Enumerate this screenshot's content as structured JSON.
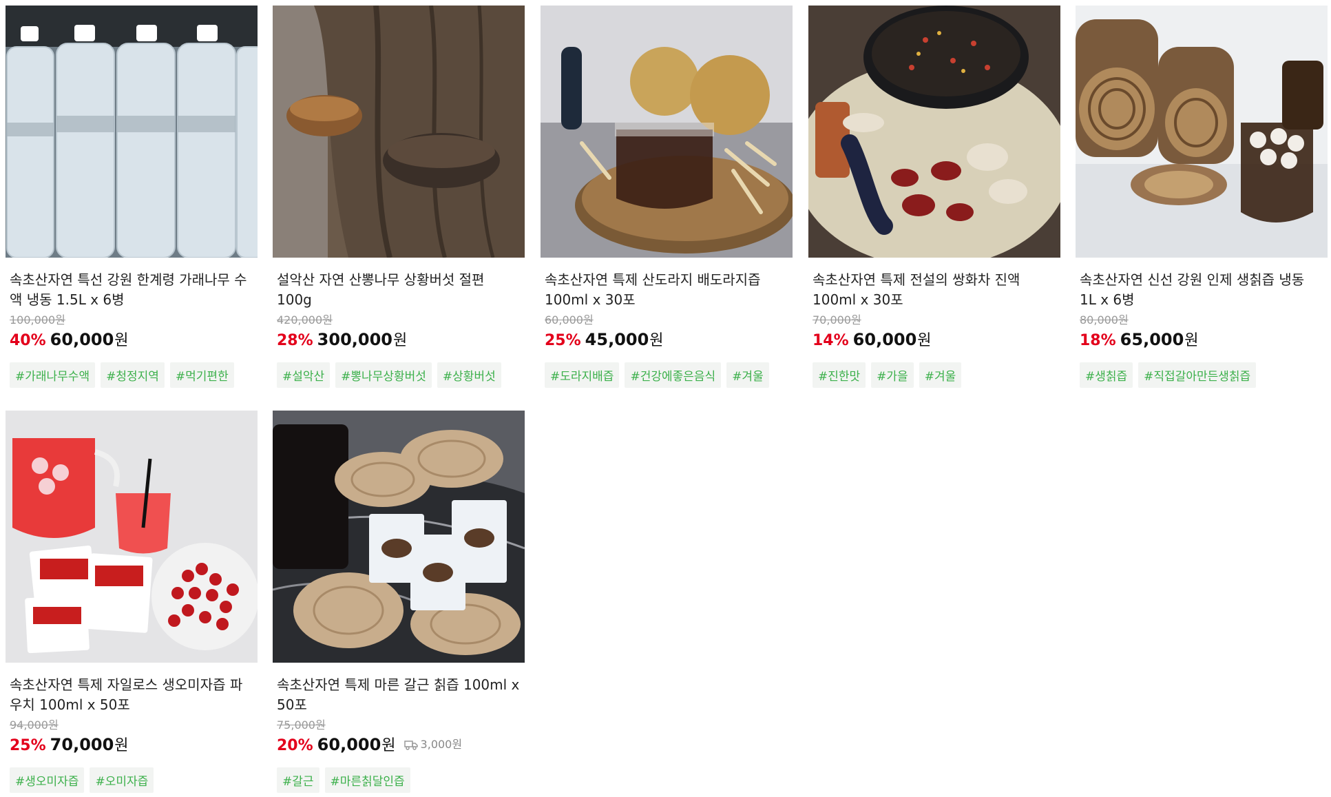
{
  "products": [
    {
      "title": "속초산자연 특선 강원 한계령 가래나무 수액 냉동 1.5L x 6병",
      "original_price": "100,000원",
      "discount": "40%",
      "price": "60,000",
      "currency": "원",
      "tags": [
        "#가래나무수액",
        "#청정지역",
        "#먹기편한"
      ],
      "image": "bottled-water-photo"
    },
    {
      "title": "설악산 자연 산뽕나무 상황버섯 절편 100g",
      "original_price": "420,000원",
      "discount": "28%",
      "price": "300,000",
      "currency": "원",
      "tags": [
        "#설악산",
        "#뽕나무상황버섯",
        "#상황버섯"
      ],
      "image": "mushroom-on-tree-photo"
    },
    {
      "title": "속초산자연 특제 산도라지 배도라지즙 100ml x 30포",
      "original_price": "60,000원",
      "discount": "25%",
      "price": "45,000",
      "currency": "원",
      "tags": [
        "#도라지배즙",
        "#건강에좋은음식",
        "#겨울"
      ],
      "image": "pear-bellflower-juice-photo"
    },
    {
      "title": "속초산자연 특제 전설의 쌍화차 진액 100ml x 30포",
      "original_price": "70,000원",
      "discount": "14%",
      "price": "60,000",
      "currency": "원",
      "tags": [
        "#진한맛",
        "#가을",
        "#겨울"
      ],
      "image": "herbal-tea-photo"
    },
    {
      "title": "속초산자연 신선 강원 인제 생칡즙 냉동 1L x 6병",
      "original_price": "80,000원",
      "discount": "18%",
      "price": "65,000",
      "currency": "원",
      "tags": [
        "#생칡즙",
        "#직접갈아만든생칡즙"
      ],
      "image": "arrowroot-juice-photo"
    },
    {
      "title": "속초산자연 특제 자일로스 생오미자즙 파우치 100ml x 50포",
      "original_price": "94,000원",
      "discount": "25%",
      "price": "70,000",
      "currency": "원",
      "tags": [
        "#생오미자즙",
        "#오미자즙"
      ],
      "image": "omija-juice-photo"
    },
    {
      "title": "속초산자연 특제 마른 갈근 칡즙 100ml x 50포",
      "original_price": "75,000원",
      "discount": "20%",
      "price": "60,000",
      "currency": "원",
      "shipping": "3,000원",
      "tags": [
        "#갈근",
        "#마른칡달인즙"
      ],
      "image": "dried-arrowroot-photo"
    }
  ]
}
